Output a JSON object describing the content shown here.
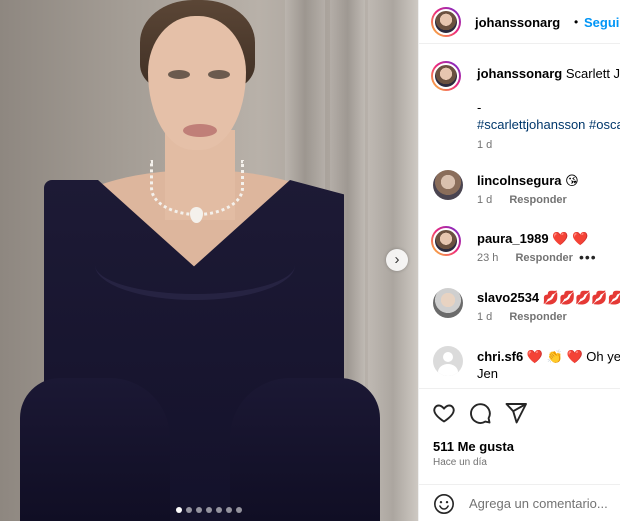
{
  "post": {
    "author": "johanssonarg",
    "follow_label": "Seguir",
    "separator": "•",
    "caption_text": "Scarlett Johansson en los Oscars 💙",
    "caption_dash": "-",
    "caption_hashtags": "#scarlettjohansson #oscars",
    "caption_time": "1 d",
    "carousel": {
      "dots": 7,
      "active_index": 0
    }
  },
  "comments": [
    {
      "user": "lincolnsegura",
      "text": "😘",
      "time": "1 d",
      "reply_label": "Responder"
    },
    {
      "user": "paura_1989",
      "text": "❤️ ❤️",
      "time": "23 h",
      "reply_label": "Responder",
      "more": "•••"
    },
    {
      "user": "slavo2534",
      "text": "💋💋💋💋💋",
      "time": "1 d",
      "reply_label": "Responder"
    },
    {
      "user": "chri.sf6",
      "text": "❤️ 👏 ❤️ Oh yes b",
      "text_line2": "Jen"
    }
  ],
  "actions": {
    "likes": "511 Me gusta",
    "time_ago": "Hace un día",
    "comment_placeholder": "Agrega un comentario..."
  },
  "colors": {
    "accent": "#0095f6",
    "muted": "#737373",
    "hashtag": "#00376b"
  }
}
